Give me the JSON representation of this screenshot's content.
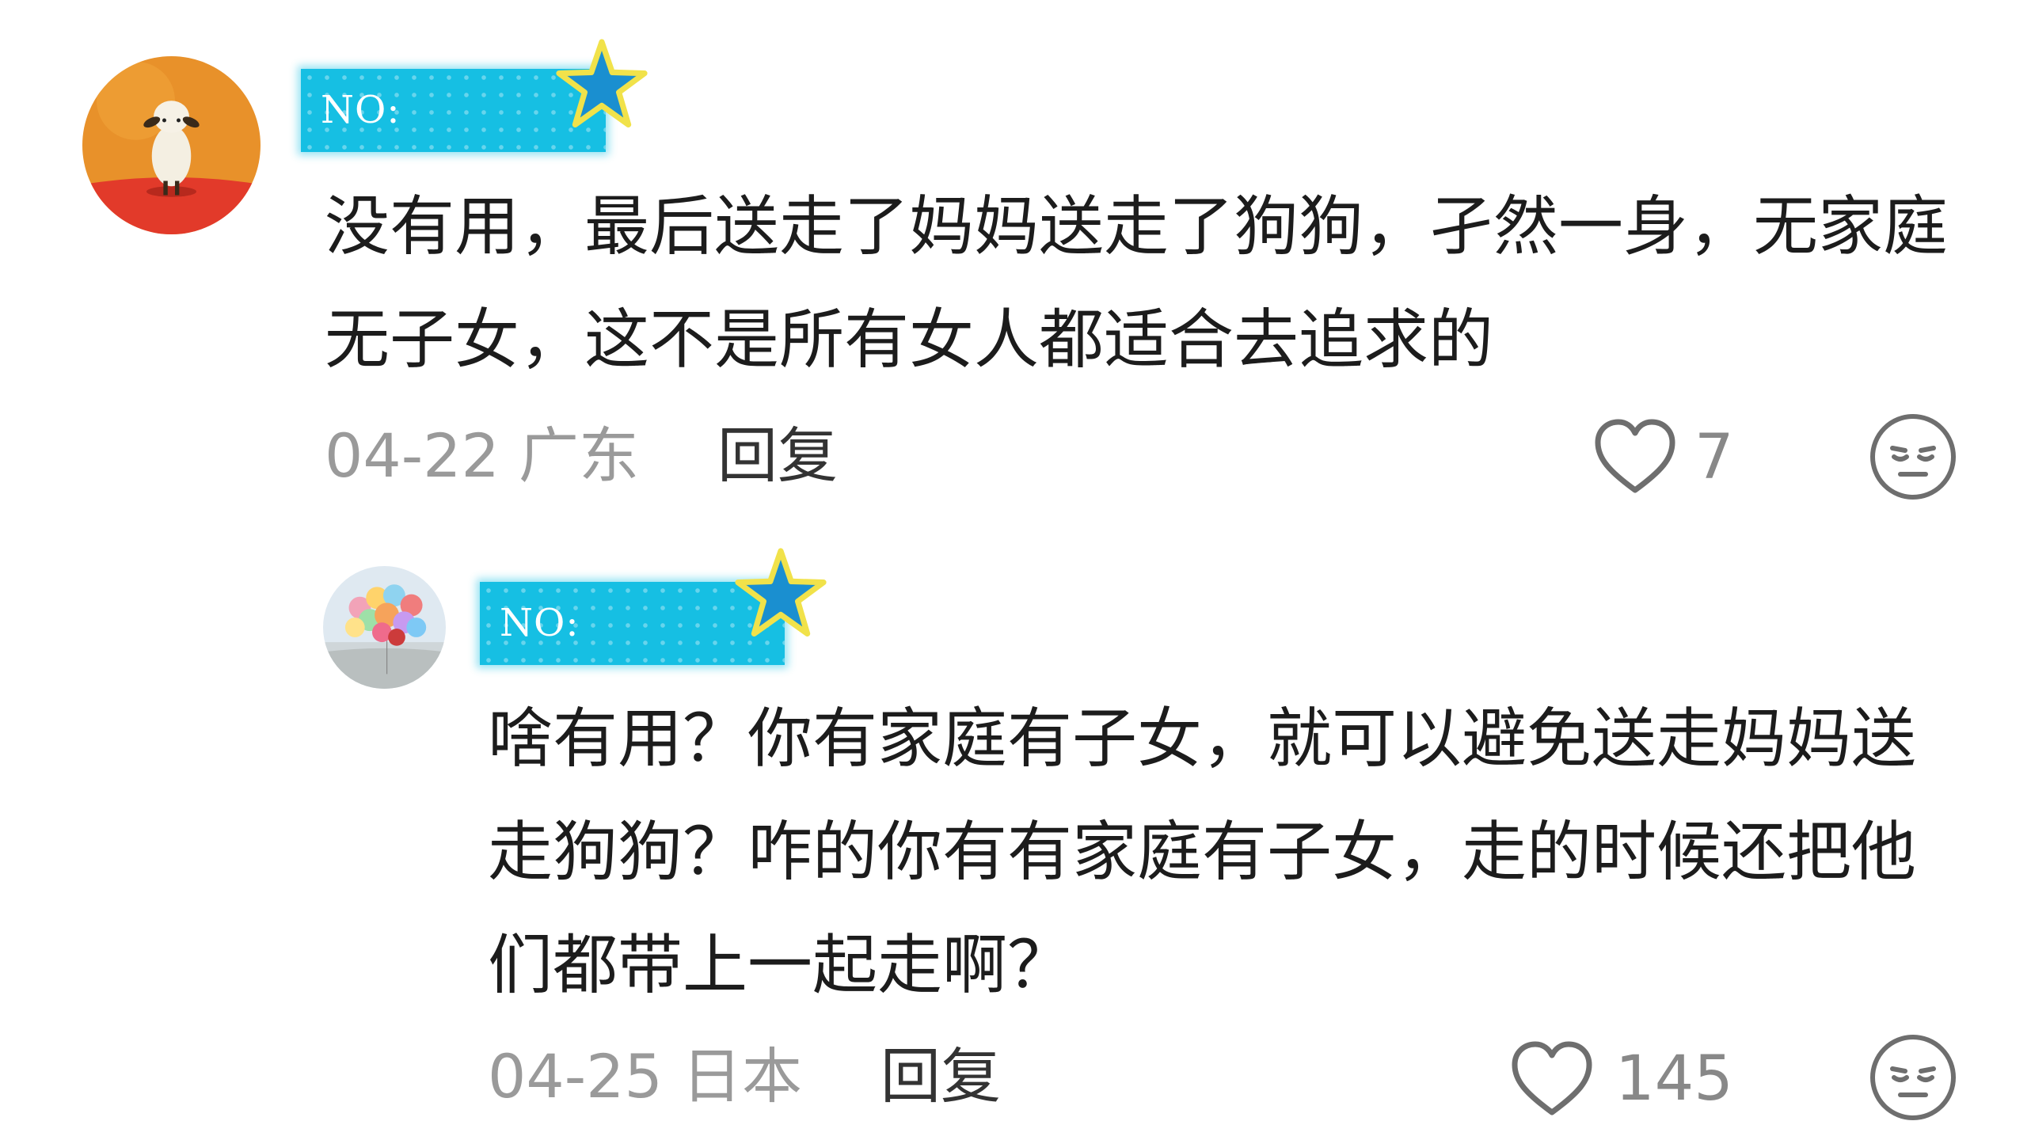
{
  "comments": [
    {
      "username": "NO:",
      "text": "没有用，最后送走了妈妈送走了狗狗，孑然一身，无家庭无子女，这不是所有女人都适合去追求的",
      "date_location": "04-22 广东",
      "reply_label": "回复",
      "likes": "7",
      "avatar_icon": "sheep-avatar-icon",
      "badge_color": "#16bfe3"
    },
    {
      "username": "NO:",
      "text": "啥有用？你有家庭有子女，就可以避免送走妈妈送走狗狗？咋的你有有家庭有子女，走的时候还把他们都带上一起走啊？",
      "date_location": "04-25 日本",
      "reply_label": "回复",
      "likes": "145",
      "avatar_icon": "balloons-avatar-icon",
      "badge_color": "#16bfe3"
    }
  ],
  "icons": {
    "like": "heart-outline-icon",
    "reaction": "expressionless-face-icon",
    "badge_decoration": "star-icon"
  }
}
